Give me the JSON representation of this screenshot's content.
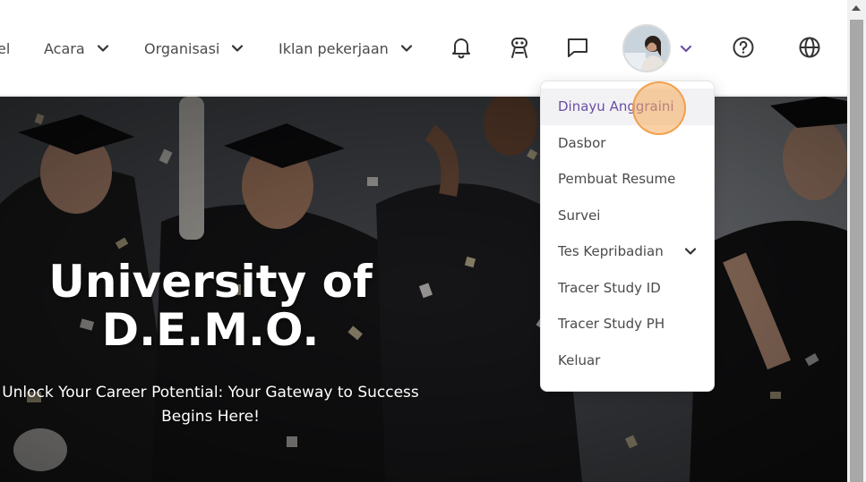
{
  "header": {
    "nav": [
      {
        "label": "el",
        "has_caret": false
      },
      {
        "label": "Acara",
        "has_caret": true
      },
      {
        "label": "Organisasi",
        "has_caret": true
      },
      {
        "label": "Iklan pekerjaan",
        "has_caret": true
      }
    ],
    "icons": [
      "bell-icon",
      "robot-icon",
      "chat-icon",
      "avatar",
      "chevron-down-icon",
      "help-icon",
      "globe-icon"
    ],
    "accent_color": "#6a4fa3"
  },
  "hero": {
    "title_line1": "University of",
    "title_line2": "D.E.M.O.",
    "subtitle_line1": "Unlock Your Career Potential: Your Gateway to Success",
    "subtitle_line2": "Begins Here!"
  },
  "dropdown": {
    "items": [
      {
        "label": "Dinayu Anggraini",
        "active": true
      },
      {
        "label": "Dasbor"
      },
      {
        "label": "Pembuat Resume"
      },
      {
        "label": "Survei"
      },
      {
        "label": "Tes Kepribadian",
        "has_caret": true
      },
      {
        "label": "Tracer Study ID"
      },
      {
        "label": "Tracer Study PH"
      },
      {
        "label": "Keluar"
      }
    ]
  }
}
